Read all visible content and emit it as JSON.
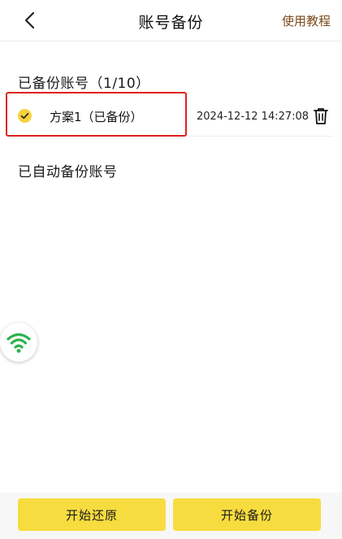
{
  "header": {
    "back_icon": "chevron-left-icon",
    "title": "账号备份",
    "tutorial_label": "使用教程"
  },
  "backups": {
    "heading": "已备份账号（1/10）",
    "items": [
      {
        "name": "方案1（已备份）",
        "time": "2024-12-12 14:27:08",
        "selected": true,
        "check_icon": "check-circle-icon",
        "delete_icon": "trash-icon"
      }
    ]
  },
  "auto_backups": {
    "heading": "已自动备份账号"
  },
  "floating": {
    "icon": "wifi-icon",
    "color": "#2bb24c"
  },
  "actions": {
    "restore_label": "开始还原",
    "backup_label": "开始备份"
  },
  "colors": {
    "accent": "#f7dc3f",
    "highlight": "#e02020",
    "tutorial": "#7a4a1a"
  }
}
